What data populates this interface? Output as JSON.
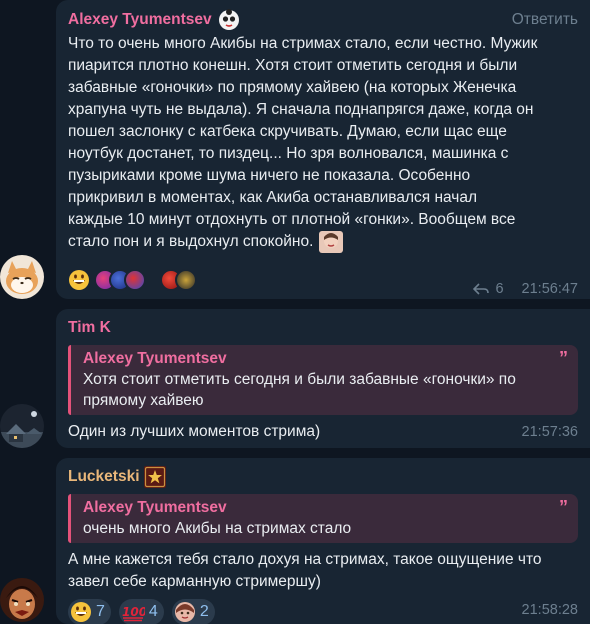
{
  "msg1": {
    "author": "Alexey Tyumentsev",
    "reply_label": "Ответить",
    "lines": [
      "Что то очень много Акибы на стримах стало, если честно. Мужик",
      "пиарится плотно конешн. Хотя стоит отметить сегодня и были",
      "забавные «гоночки» по прямому хайвею (на которых Женечка",
      "храпуна чуть не выдала). Я сначала поднапрягся даже, когда он",
      "пошел заслонку с катбека скручивать. Думаю, если щас еще",
      "ноутбук достанет, то пиздец... Но зря волновался, машинка с",
      "пузыриками кроме шума ничего не показала. Особенно",
      "прикривил в моментах, как Акиба останавливался начал",
      "каждые 10 минут отдохнуть от плотной «гонки». Вообщем все",
      "стало пон и я выдохнул спокойно."
    ],
    "forwards": "6",
    "time": "21:56:47"
  },
  "msg2": {
    "author": "Tim K",
    "quote_author": "Alexey Tyumentsev",
    "quote_lines": [
      "Хотя стоит отметить сегодня и были забавные «гоночки» по",
      "прямому хайвею"
    ],
    "text": "Один из лучших моментов стрима)",
    "time": "21:57:36"
  },
  "msg3": {
    "author": "Lucketski",
    "quote_author": "Alexey Tyumentsev",
    "quote_text": "очень много Акибы на стримах стало",
    "lines": [
      "А мне кажется тебя стало дохуя на стримах, такое ощущение что",
      "завел себе карманную стримершу)"
    ],
    "reactions": [
      {
        "emoji": "grinning-face",
        "count": "7"
      },
      {
        "emoji": "hundred-points",
        "count": "4"
      },
      {
        "emoji": "user-avatar",
        "count": "2"
      }
    ],
    "time": "21:58:28"
  },
  "colors": {
    "name_alexey": "#f06ea0",
    "name_tim": "#f06ea0",
    "name_lucketski": "#e9b77a",
    "quote_accent": "#e4527a"
  }
}
